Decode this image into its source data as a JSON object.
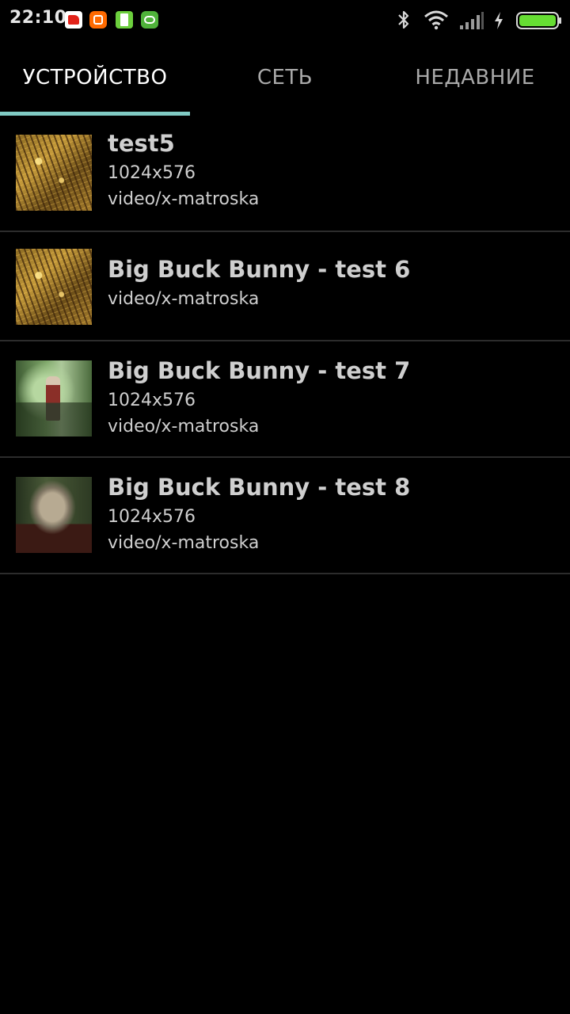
{
  "status_bar": {
    "time": "22:10",
    "notification_icons": [
      "app-notification-icon",
      "mi-app-icon",
      "battery-app-icon",
      "cat-app-icon"
    ],
    "system_icons": [
      "bluetooth-icon",
      "wifi-icon",
      "signal-icon",
      "charging-icon",
      "battery-icon"
    ],
    "battery_color": "#66dd33"
  },
  "tabs": {
    "device": "УСТРОЙСТВО",
    "network": "СЕТЬ",
    "recent": "НЕДАВНИЕ",
    "active": "device",
    "indicator_color": "#80cbc4"
  },
  "media_list": [
    {
      "title": "test5",
      "resolution": "1024x576",
      "mime": "video/x-matroska"
    },
    {
      "title": "Big Buck Bunny - test 6",
      "mime": "video/x-matroska"
    },
    {
      "title": "Big Buck Bunny - test 7",
      "resolution": "1024x576",
      "mime": "video/x-matroska"
    },
    {
      "title": "Big Buck Bunny - test 8",
      "resolution": "1024x576",
      "mime": "video/x-matroska"
    }
  ]
}
